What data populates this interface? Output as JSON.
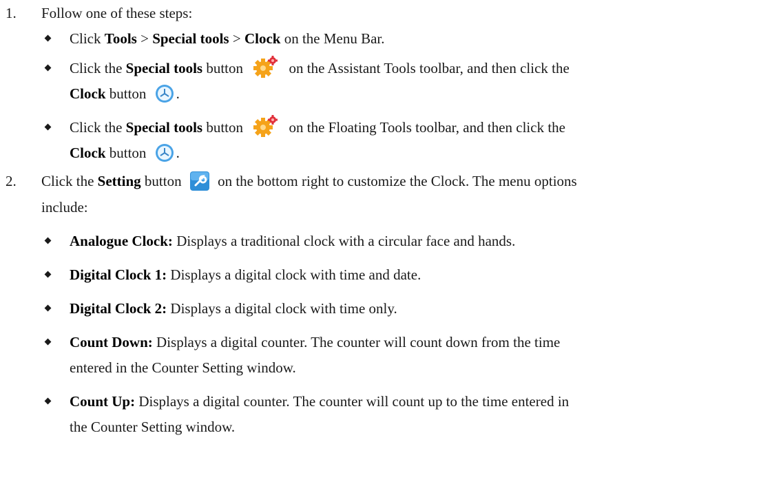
{
  "steps": [
    {
      "number": "1.",
      "text": "Follow one of these steps:",
      "bullets": [
        {
          "parts": [
            {
              "t": "Click ",
              "b": false
            },
            {
              "t": "Tools",
              "b": true
            },
            {
              "t": " > ",
              "b": false
            },
            {
              "t": "Special tools",
              "b": true
            },
            {
              "t": " > ",
              "b": false
            },
            {
              "t": "Clock",
              "b": true
            },
            {
              "t": " on the Menu Bar.",
              "b": false
            }
          ]
        },
        {
          "line1": {
            "pre": "Click the ",
            "bold": "Special tools",
            "mid": " button",
            "post": " on the Assistant Tools toolbar, and then click the"
          },
          "line2": {
            "bold": "Clock",
            "mid": " button",
            "post": "."
          }
        },
        {
          "line1": {
            "pre": "Click the ",
            "bold": "Special tools",
            "mid": " button",
            "post": " on the Floating Tools toolbar, and then click the"
          },
          "line2": {
            "bold": "Clock",
            "mid": " button",
            "post": "."
          }
        }
      ]
    },
    {
      "number": "2.",
      "line1": {
        "pre": "Click the ",
        "bold": "Setting",
        "mid": " button",
        "post": " on the bottom right to customize the Clock. The menu options"
      },
      "line2": "include:",
      "options": [
        {
          "label": "Analogue Clock:",
          "desc": " Displays a traditional clock with a circular face and hands."
        },
        {
          "label": "Digital Clock 1:",
          "desc": " Displays a digital clock with time and date."
        },
        {
          "label": "Digital Clock 2:",
          "desc": " Displays a digital clock with time only."
        },
        {
          "label": "Count Down:",
          "desc": " Displays a digital counter. The counter will count down from the time",
          "cont": "entered in the Counter Setting window."
        },
        {
          "label": "Count Up:",
          "desc": " Displays a digital counter. The counter will count up to the time entered in",
          "cont": "the Counter Setting window."
        }
      ]
    }
  ],
  "icons": {
    "special_tools": "gear-icon",
    "clock": "clock-icon",
    "setting": "wrench-icon",
    "accent_orange": "#f5a31a",
    "accent_red": "#e0303a",
    "accent_blue": "#2f8fd8"
  }
}
